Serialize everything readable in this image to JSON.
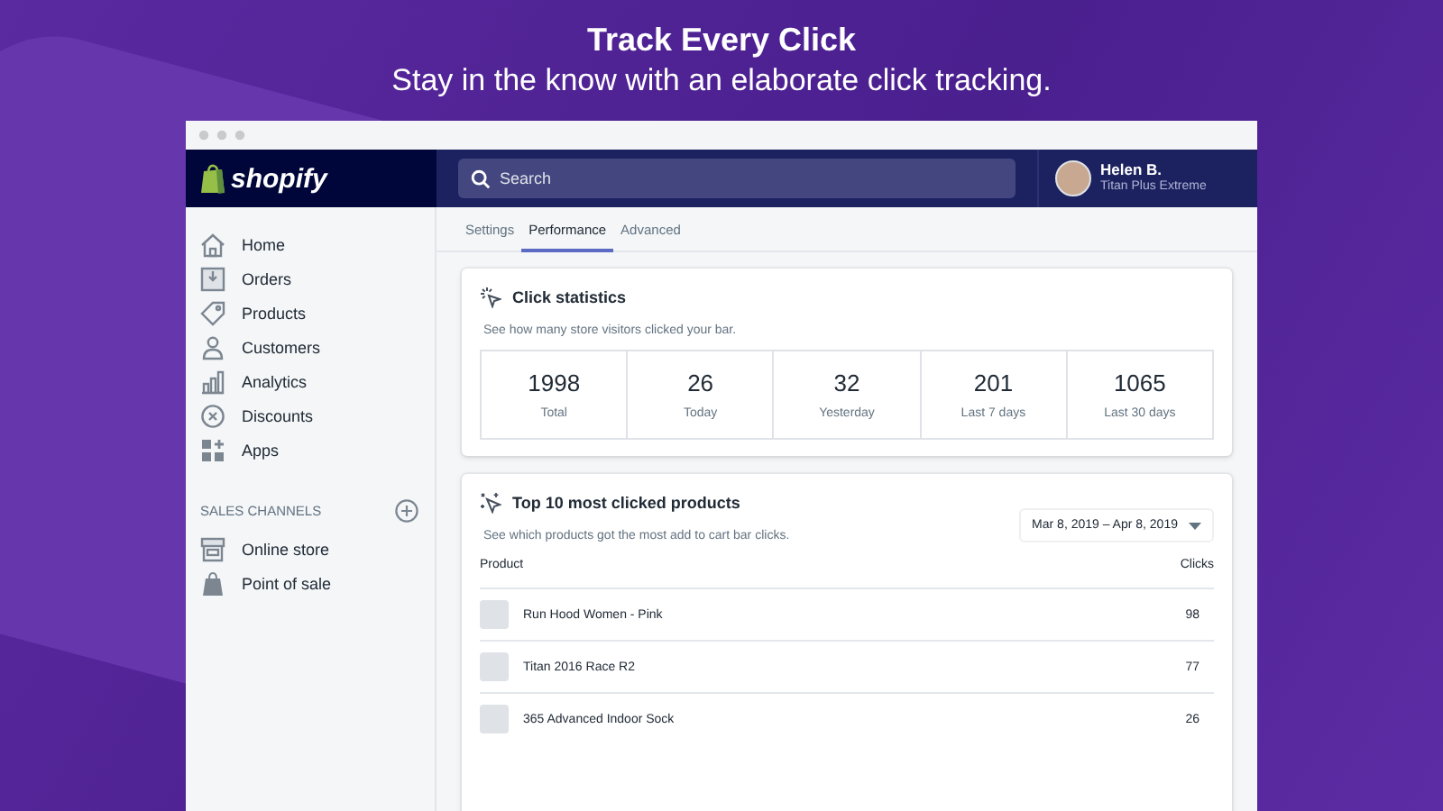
{
  "headline": {
    "title": "Track Every Click",
    "subtitle": "Stay in the know with an elaborate click tracking."
  },
  "topbar": {
    "logo": "shopify",
    "search": {
      "placeholder": "Search"
    },
    "user": {
      "name": "Helen B.",
      "store": "Titan Plus Extreme"
    }
  },
  "sidebar": {
    "items": [
      {
        "label": "Home"
      },
      {
        "label": "Orders"
      },
      {
        "label": "Products"
      },
      {
        "label": "Customers"
      },
      {
        "label": "Analytics"
      },
      {
        "label": "Discounts"
      },
      {
        "label": "Apps"
      }
    ],
    "section": "SALES CHANNELS",
    "channels": [
      {
        "label": "Online store"
      },
      {
        "label": "Point of sale"
      }
    ]
  },
  "tabs": [
    {
      "label": "Settings",
      "selected": false
    },
    {
      "label": "Performance",
      "selected": true
    },
    {
      "label": "Advanced",
      "selected": false
    }
  ],
  "click_statistics": {
    "title": "Click statistics",
    "description": "See how many store visitors clicked your bar.",
    "stats": [
      {
        "value": "1998",
        "label": "Total"
      },
      {
        "value": "26",
        "label": "Today"
      },
      {
        "value": "32",
        "label": "Yesterday"
      },
      {
        "value": "201",
        "label": "Last 7 days"
      },
      {
        "value": "1065",
        "label": "Last 30 days"
      }
    ]
  },
  "top_products": {
    "title": "Top 10 most clicked products",
    "description": "See which products got the most add to cart bar clicks.",
    "date_range": "Mar 8, 2019 – Apr 8, 2019",
    "columns": [
      "Product",
      "Clicks"
    ],
    "rows": [
      {
        "product": "Run Hood Women - Pink",
        "clicks": "98"
      },
      {
        "product": "Titan 2016 Race R2",
        "clicks": "77"
      },
      {
        "product": "365 Advanced Indoor Sock",
        "clicks": "26"
      }
    ]
  }
}
